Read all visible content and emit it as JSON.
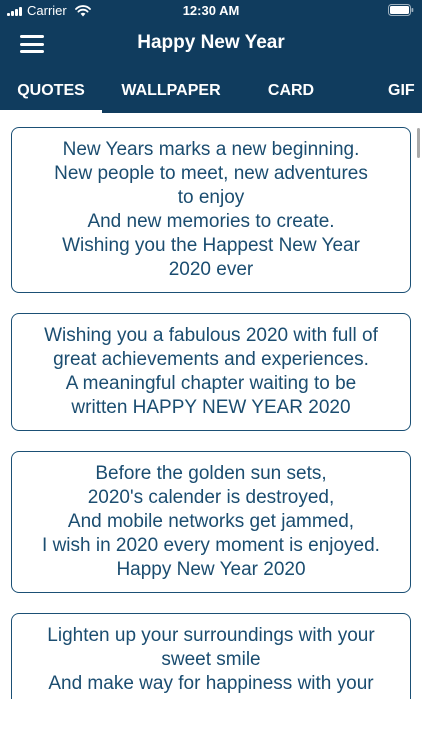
{
  "status_bar": {
    "carrier": "Carrier",
    "time": "12:30 AM",
    "icons": [
      "signal-icon",
      "wifi-icon",
      "battery-icon"
    ]
  },
  "nav": {
    "title": "Happy New Year",
    "menu_icon": "hamburger-menu-icon"
  },
  "tabs": [
    {
      "label": "QUOTES",
      "active": true
    },
    {
      "label": "WALLPAPER",
      "active": false
    },
    {
      "label": "CARD",
      "active": false
    },
    {
      "label": "GIF",
      "active": false
    }
  ],
  "quotes": [
    {
      "text": "New Years marks a new beginning.\nNew people to meet, new adventures\nto enjoy\nAnd new memories to create.\nWishing you the Happest New Year\n2020 ever"
    },
    {
      "text": "Wishing you a fabulous 2020 with full of\ngreat achievements and experiences.\nA meaningful chapter waiting to be\nwritten HAPPY NEW YEAR 2020"
    },
    {
      "text": "Before the golden sun sets,\n2020's calender is destroyed,\nAnd mobile networks get jammed,\nI wish in 2020 every moment is enjoyed.\nHappy New Year 2020"
    },
    {
      "text": "Lighten up your surroundings with your\nsweet smile\nAnd make way for happiness with your"
    }
  ],
  "colors": {
    "header_background": "#103c5e",
    "card_border": "#1b5075",
    "quote_text": "#1b4d70",
    "page_background": "#ffffff"
  }
}
